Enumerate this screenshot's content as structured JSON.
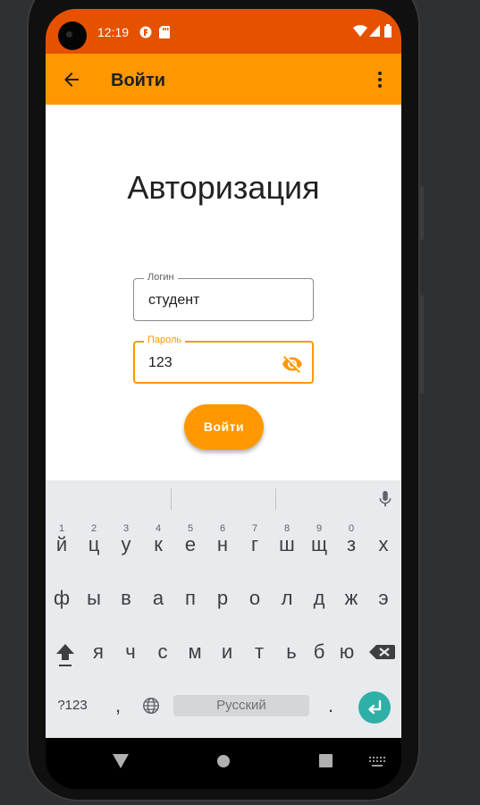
{
  "status_bar": {
    "time": "12:19",
    "icons": [
      "notification-app-icon",
      "sd-card-icon",
      "wifi-icon",
      "signal-icon",
      "battery-icon"
    ],
    "color": "#e65100"
  },
  "app_bar": {
    "title": "Войти",
    "back_icon": "arrow-back-icon",
    "menu_icon": "more-vert-icon",
    "color": "#ff9800"
  },
  "screen": {
    "heading": "Авторизация"
  },
  "form": {
    "login": {
      "label": "Логин",
      "value": "студент"
    },
    "password": {
      "label": "Пароль",
      "value": "123",
      "toggle_icon": "visibility-off-icon"
    },
    "submit_label": "Войти"
  },
  "keyboard": {
    "row1": [
      {
        "key": "й",
        "hint": "1"
      },
      {
        "key": "ц",
        "hint": "2"
      },
      {
        "key": "у",
        "hint": "3"
      },
      {
        "key": "к",
        "hint": "4"
      },
      {
        "key": "е",
        "hint": "5"
      },
      {
        "key": "н",
        "hint": "6"
      },
      {
        "key": "г",
        "hint": "7"
      },
      {
        "key": "ш",
        "hint": "8"
      },
      {
        "key": "щ",
        "hint": "9"
      },
      {
        "key": "з",
        "hint": "0"
      },
      {
        "key": "х",
        "hint": ""
      }
    ],
    "row2": [
      "ф",
      "ы",
      "в",
      "а",
      "п",
      "р",
      "о",
      "л",
      "д",
      "ж",
      "э"
    ],
    "row3": [
      "я",
      "ч",
      "с",
      "м",
      "и",
      "т",
      "ь",
      "б",
      "ю"
    ],
    "symbols_label": "?123",
    "comma": ",",
    "period": ".",
    "space_label": "Русский",
    "accent_color": "#2eb0a6"
  },
  "nav_bar": {
    "icons": [
      "back-triangle-icon",
      "home-circle-icon",
      "recents-square-icon",
      "keyboard-switch-icon"
    ]
  }
}
